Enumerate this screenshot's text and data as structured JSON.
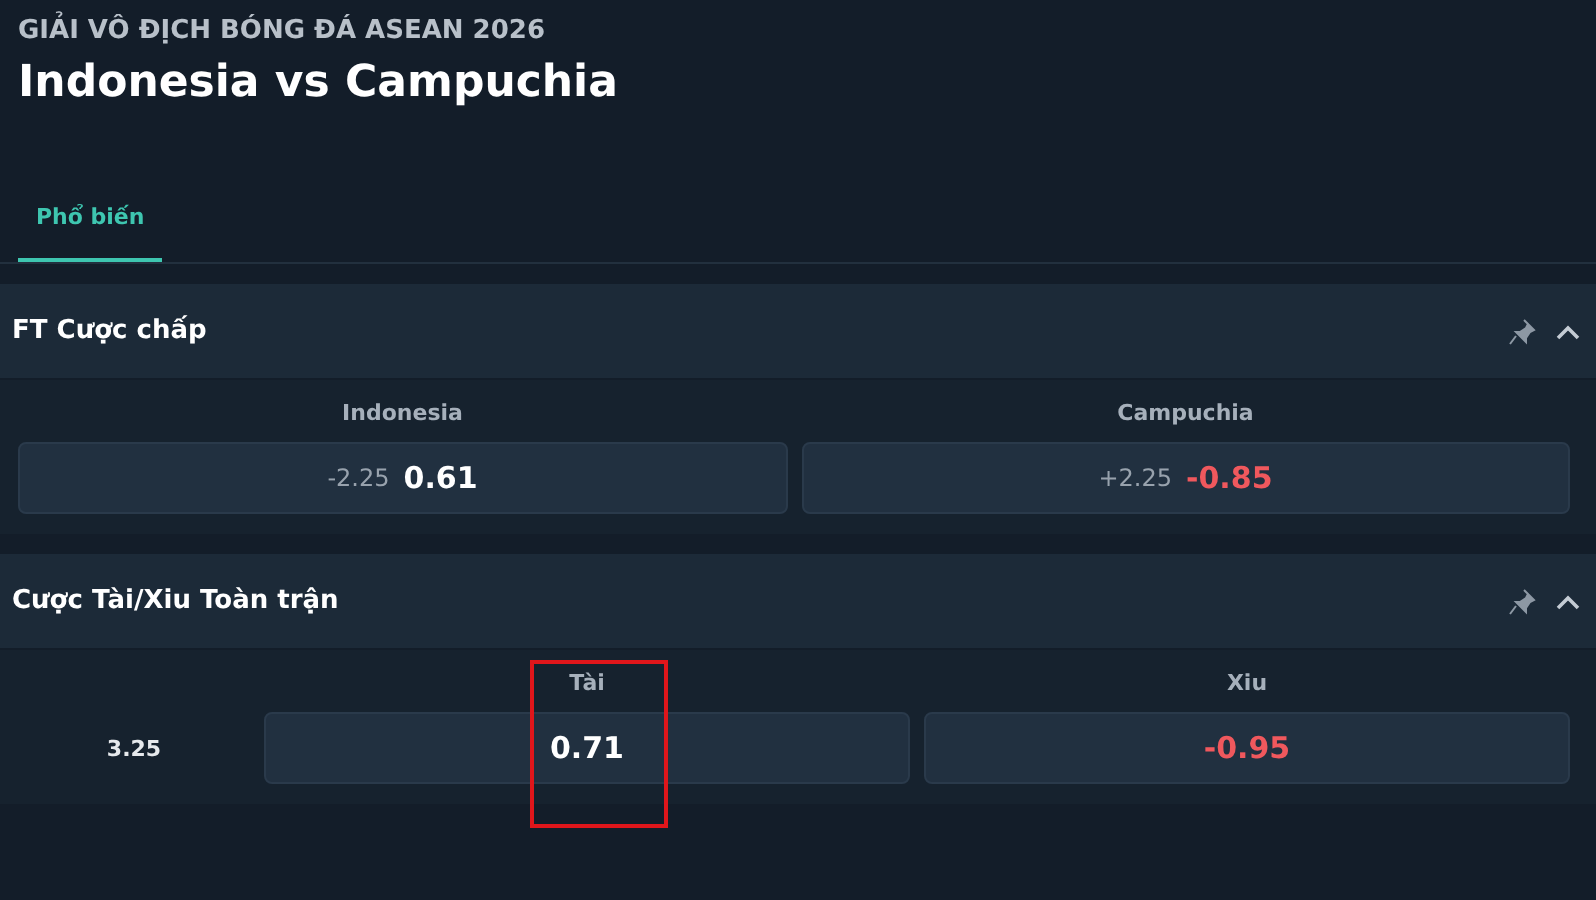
{
  "header": {
    "league": "GIẢI VÔ ĐỊCH BÓNG ĐÁ ASEAN 2026",
    "match": "Indonesia vs Campuchia"
  },
  "tabs": [
    {
      "label": "Phổ biến",
      "selected": true
    }
  ],
  "markets": [
    {
      "title": "FT Cược chấp",
      "kind": "handicap",
      "outcomes": [
        {
          "name": "Indonesia",
          "line": "-2.25",
          "odds": "0.61",
          "negative": false,
          "highlighted": false
        },
        {
          "name": "Campuchia",
          "line": "+2.25",
          "odds": "-0.85",
          "negative": true,
          "highlighted": false
        }
      ]
    },
    {
      "title": "Cược Tài/Xiu Toàn trận",
      "kind": "total",
      "row_label": "3.25",
      "outcomes": [
        {
          "name": "Tài",
          "odds": "0.71",
          "negative": false,
          "highlighted": true
        },
        {
          "name": "Xiu",
          "odds": "-0.95",
          "negative": true,
          "highlighted": false
        }
      ]
    }
  ]
}
